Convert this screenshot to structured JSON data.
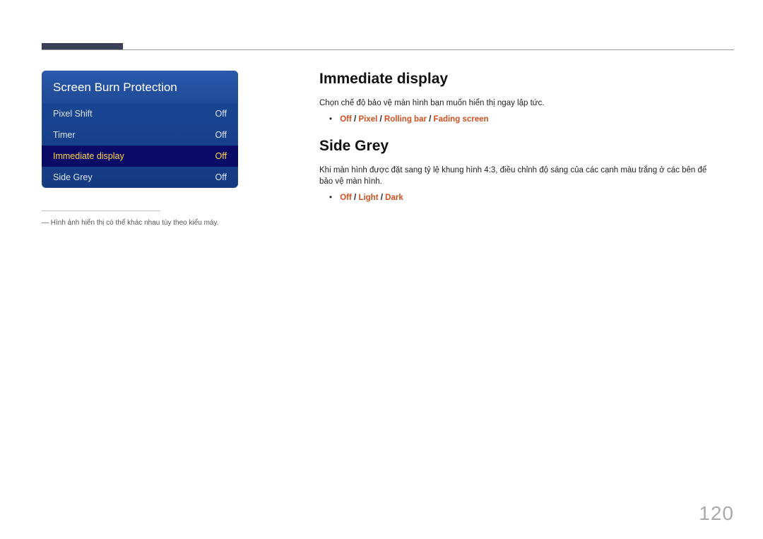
{
  "page_number": "120",
  "menu": {
    "title": "Screen Burn Protection",
    "items": [
      {
        "label": "Pixel Shift",
        "value": "Off",
        "selected": false
      },
      {
        "label": "Timer",
        "value": "Off",
        "selected": false
      },
      {
        "label": "Immediate display",
        "value": "Off",
        "selected": true
      },
      {
        "label": "Side Grey",
        "value": "Off",
        "selected": false
      }
    ]
  },
  "footnote": "― Hình ảnh hiển thị có thể khác nhau tùy theo kiểu máy.",
  "sections": {
    "immediate": {
      "heading": "Immediate display",
      "desc": "Chọn chế độ bảo vệ màn hình bạn muốn hiển thị ngay lập tức.",
      "options": [
        "Off",
        "Pixel",
        "Rolling bar",
        "Fading screen"
      ],
      "sep": " / "
    },
    "sidegrey": {
      "heading": "Side Grey",
      "desc": "Khi màn hình được đặt sang tỷ lệ khung hình 4:3, điều chỉnh độ sáng của các cạnh màu trắng ở các bên để bảo vệ màn hình.",
      "options": [
        "Off",
        "Light",
        "Dark"
      ],
      "sep": " / "
    }
  }
}
